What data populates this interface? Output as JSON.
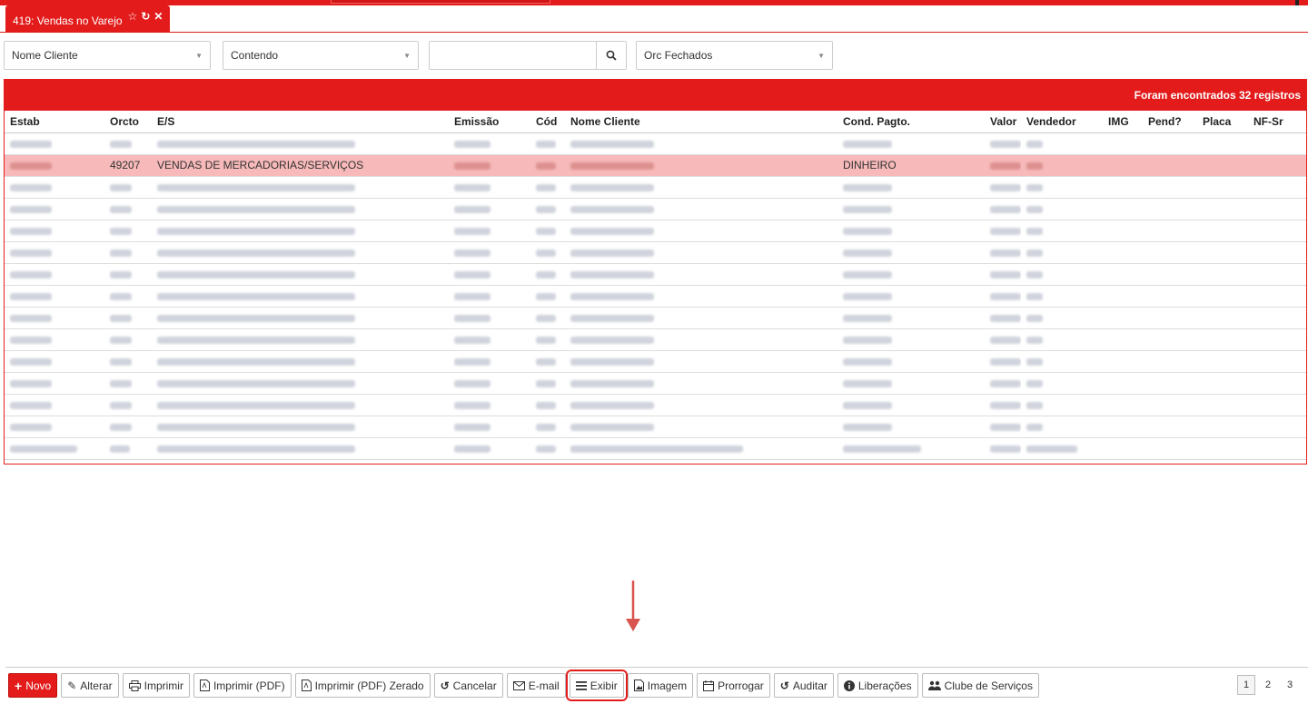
{
  "tab": {
    "title": "419: Vendas no Varejo"
  },
  "filters": {
    "field": "Nome Cliente",
    "operator": "Contendo",
    "search_value": "",
    "status": "Orc Fechados"
  },
  "grid": {
    "count_text": "Foram encontrados 32 registros",
    "columns": [
      "Estab",
      "Orcto",
      "E/S",
      "Emissão",
      "Cód",
      "Nome Cliente",
      "Cond. Pagto.",
      "Valor",
      "Vendedor",
      "IMG",
      "Pend?",
      "Placa",
      "NF-Sr"
    ],
    "selected_row": {
      "orcto": "49207",
      "es": "VENDAS DE MERCADORIAS/SERVIÇOS",
      "cond_pagto": "DINHEIRO"
    }
  },
  "toolbar": {
    "buttons": [
      {
        "label": "Novo",
        "icon": "plus-icon"
      },
      {
        "label": "Alterar",
        "icon": "pencil-icon"
      },
      {
        "label": "Imprimir",
        "icon": "printer-icon"
      },
      {
        "label": "Imprimir (PDF)",
        "icon": "pdf-icon"
      },
      {
        "label": "Imprimir (PDF) Zerado",
        "icon": "pdf-icon"
      },
      {
        "label": "Cancelar",
        "icon": "undo-icon"
      },
      {
        "label": "E-mail",
        "icon": "envelope-icon"
      },
      {
        "label": "Exibir",
        "icon": "list-icon"
      },
      {
        "label": "Imagem",
        "icon": "image-icon"
      },
      {
        "label": "Prorrogar",
        "icon": "calendar-icon"
      },
      {
        "label": "Auditar",
        "icon": "history-icon"
      },
      {
        "label": "Liberações",
        "icon": "info-icon"
      },
      {
        "label": "Clube de Serviços",
        "icon": "users-icon"
      }
    ]
  },
  "pager": {
    "pages": [
      "1",
      "2",
      "3"
    ],
    "current": "1"
  },
  "colors": {
    "accent": "#e31b1b",
    "selected_row": "#f7b9b9"
  }
}
